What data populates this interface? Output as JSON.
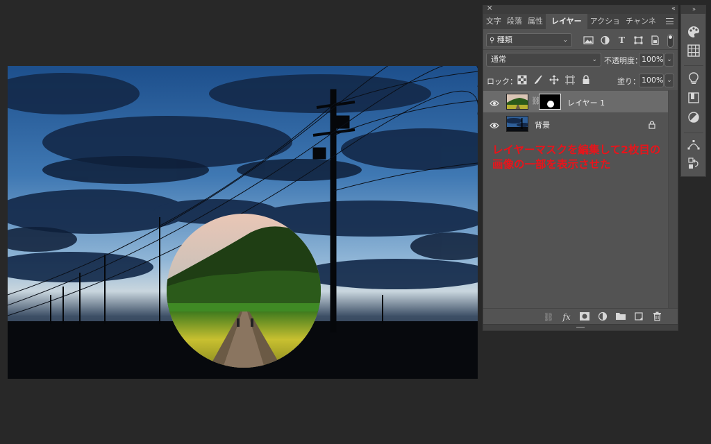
{
  "panel": {
    "tabs": [
      "文字",
      "段落",
      "属性",
      "レイヤー",
      "アクショ",
      "チャンネ"
    ],
    "active_tab_index": 3,
    "filter": {
      "kind": "種類"
    },
    "blend_mode": "通常",
    "opacity_label": "不透明度：",
    "opacity": "100%",
    "lock_label": "ロック：",
    "fill_label": "塗り：",
    "fill": "100%",
    "layers": [
      {
        "name": "レイヤー 1",
        "visible": true,
        "selected": true,
        "has_mask": true
      },
      {
        "name": "背景",
        "visible": true,
        "selected": false,
        "locked": true
      }
    ],
    "annotation": "レイヤーマスクを編集して2枚目の画像の一部を表示させた"
  },
  "colors": {
    "app_bg": "#282828",
    "panel_bg": "#535353",
    "selected_row": "#6b6b6b",
    "annotation": "#e8141b"
  }
}
